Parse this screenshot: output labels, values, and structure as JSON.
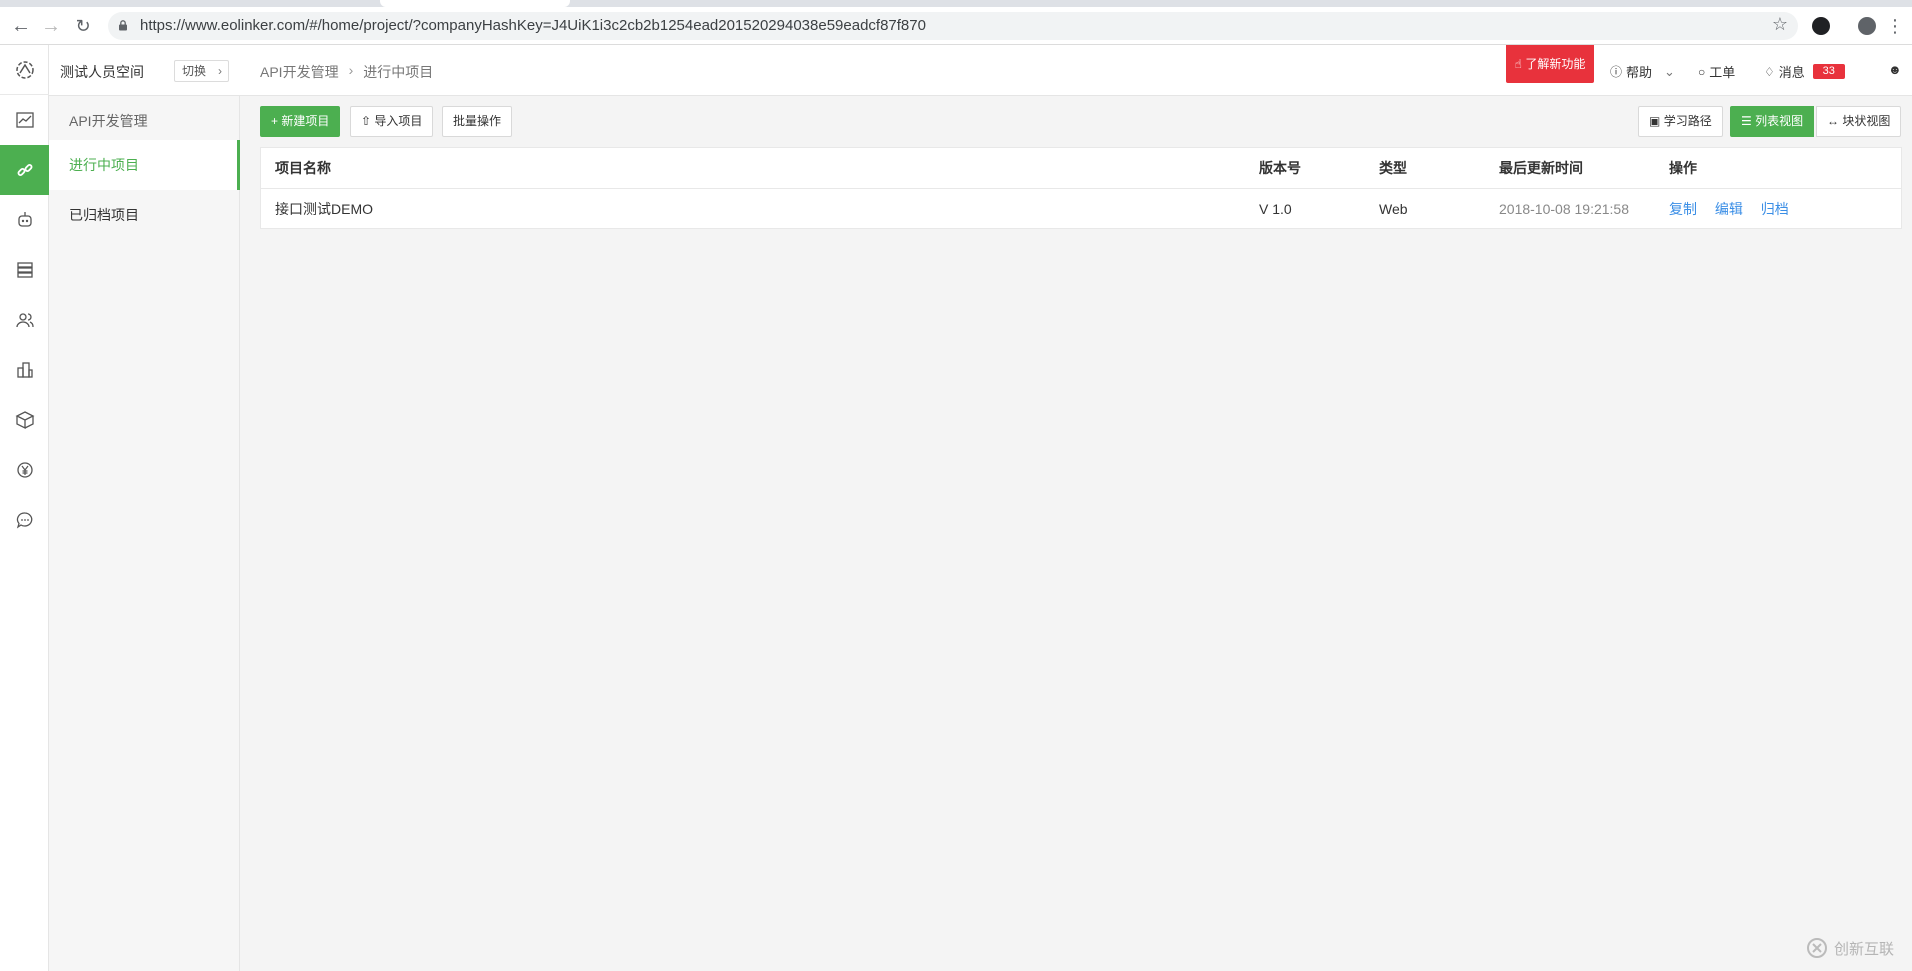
{
  "browser": {
    "url": "https://www.eolinker.com/#/home/project/?companyHashKey=J4UiK1i3c2cb2b1254ead201520294038e59eadcf87f870"
  },
  "sidebar": {
    "space_name": "测试人员空间",
    "switch_label": "切换",
    "group_title": "API开发管理",
    "items": [
      {
        "label": "进行中项目"
      },
      {
        "label": "已归档项目"
      }
    ]
  },
  "header": {
    "breadcrumb": [
      "API开发管理",
      "进行中项目"
    ],
    "feature_label": "了解新功能",
    "help_label": "帮助",
    "ticket_label": "工单",
    "messages_label": "消息",
    "messages_count": "33"
  },
  "toolbar": {
    "new_project": "新建项目",
    "import_project": "导入项目",
    "batch_ops": "批量操作",
    "learning_path": "学习路径",
    "list_view": "列表视图",
    "block_view": "块状视图"
  },
  "table": {
    "columns": [
      "项目名称",
      "版本号",
      "类型",
      "最后更新时间",
      "操作"
    ],
    "rows": [
      {
        "name": "接口测试DEMO",
        "version": "V 1.0",
        "type": "Web",
        "updated": "2018-10-08 19:21:58",
        "actions": [
          "复制",
          "编辑",
          "归档"
        ]
      }
    ]
  },
  "watermark": {
    "text": "创新互联"
  },
  "colors": {
    "accent": "#4caf50",
    "alert": "#e8323c",
    "link": "#3a8ee6"
  },
  "icons": {
    "rail": [
      "dashboard-chart-icon",
      "api-link-icon",
      "robot-icon",
      "database-icon",
      "team-icon",
      "buildings-icon",
      "package-box-icon",
      "billing-yen-icon",
      "chat-bubble-icon"
    ]
  }
}
